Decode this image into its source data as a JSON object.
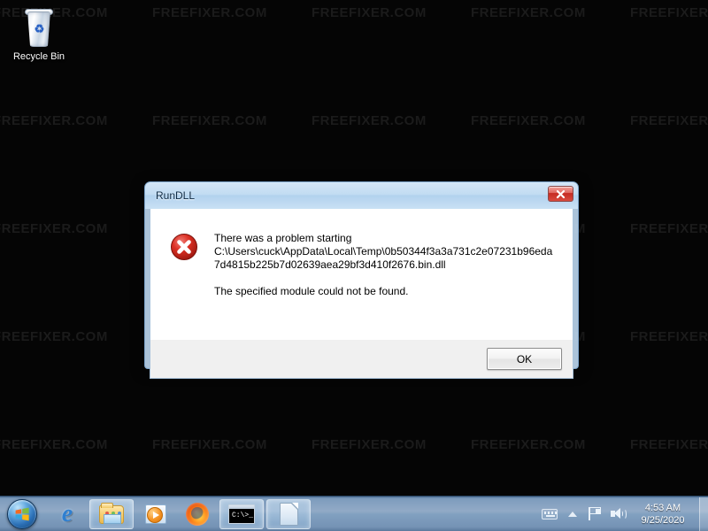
{
  "desktop": {
    "watermark_text": "FREEFIXER.COM",
    "background_color": "#050505",
    "icons": [
      {
        "name": "recycle-bin",
        "label": "Recycle Bin"
      }
    ]
  },
  "dialog": {
    "title": "RunDLL",
    "close_button_label": "x",
    "error_icon": "error-x-icon",
    "message": {
      "line1": "There was a problem starting",
      "line2": "C:\\Users\\cuck\\AppData\\Local\\Temp\\0b50344f3a3a731c2e07231b96eda",
      "line3": "7d4815b225b7d02639aea29bf3d410f2676.bin.dll",
      "line4": "The specified module could not be found."
    },
    "ok_label": "OK"
  },
  "taskbar": {
    "start_label": "Start",
    "buttons": [
      {
        "name": "internet-explorer",
        "label": "Internet Explorer",
        "state": "quick"
      },
      {
        "name": "windows-explorer",
        "label": "Windows Explorer",
        "state": "active"
      },
      {
        "name": "windows-media-player",
        "label": "Windows Media Player",
        "state": "quick"
      },
      {
        "name": "firefox",
        "label": "Mozilla Firefox",
        "state": "quick"
      },
      {
        "name": "command-prompt",
        "label": "Command Prompt",
        "state": "active",
        "text": "C:\\>_"
      },
      {
        "name": "document",
        "label": "Document",
        "state": "active"
      }
    ],
    "tray": [
      {
        "name": "tablet-input-panel-icon"
      },
      {
        "name": "show-hidden-icons-icon"
      },
      {
        "name": "action-center-flag-icon"
      },
      {
        "name": "volume-speaker-icon"
      }
    ],
    "clock": {
      "time": "4:53 AM",
      "date": "9/25/2020"
    }
  }
}
